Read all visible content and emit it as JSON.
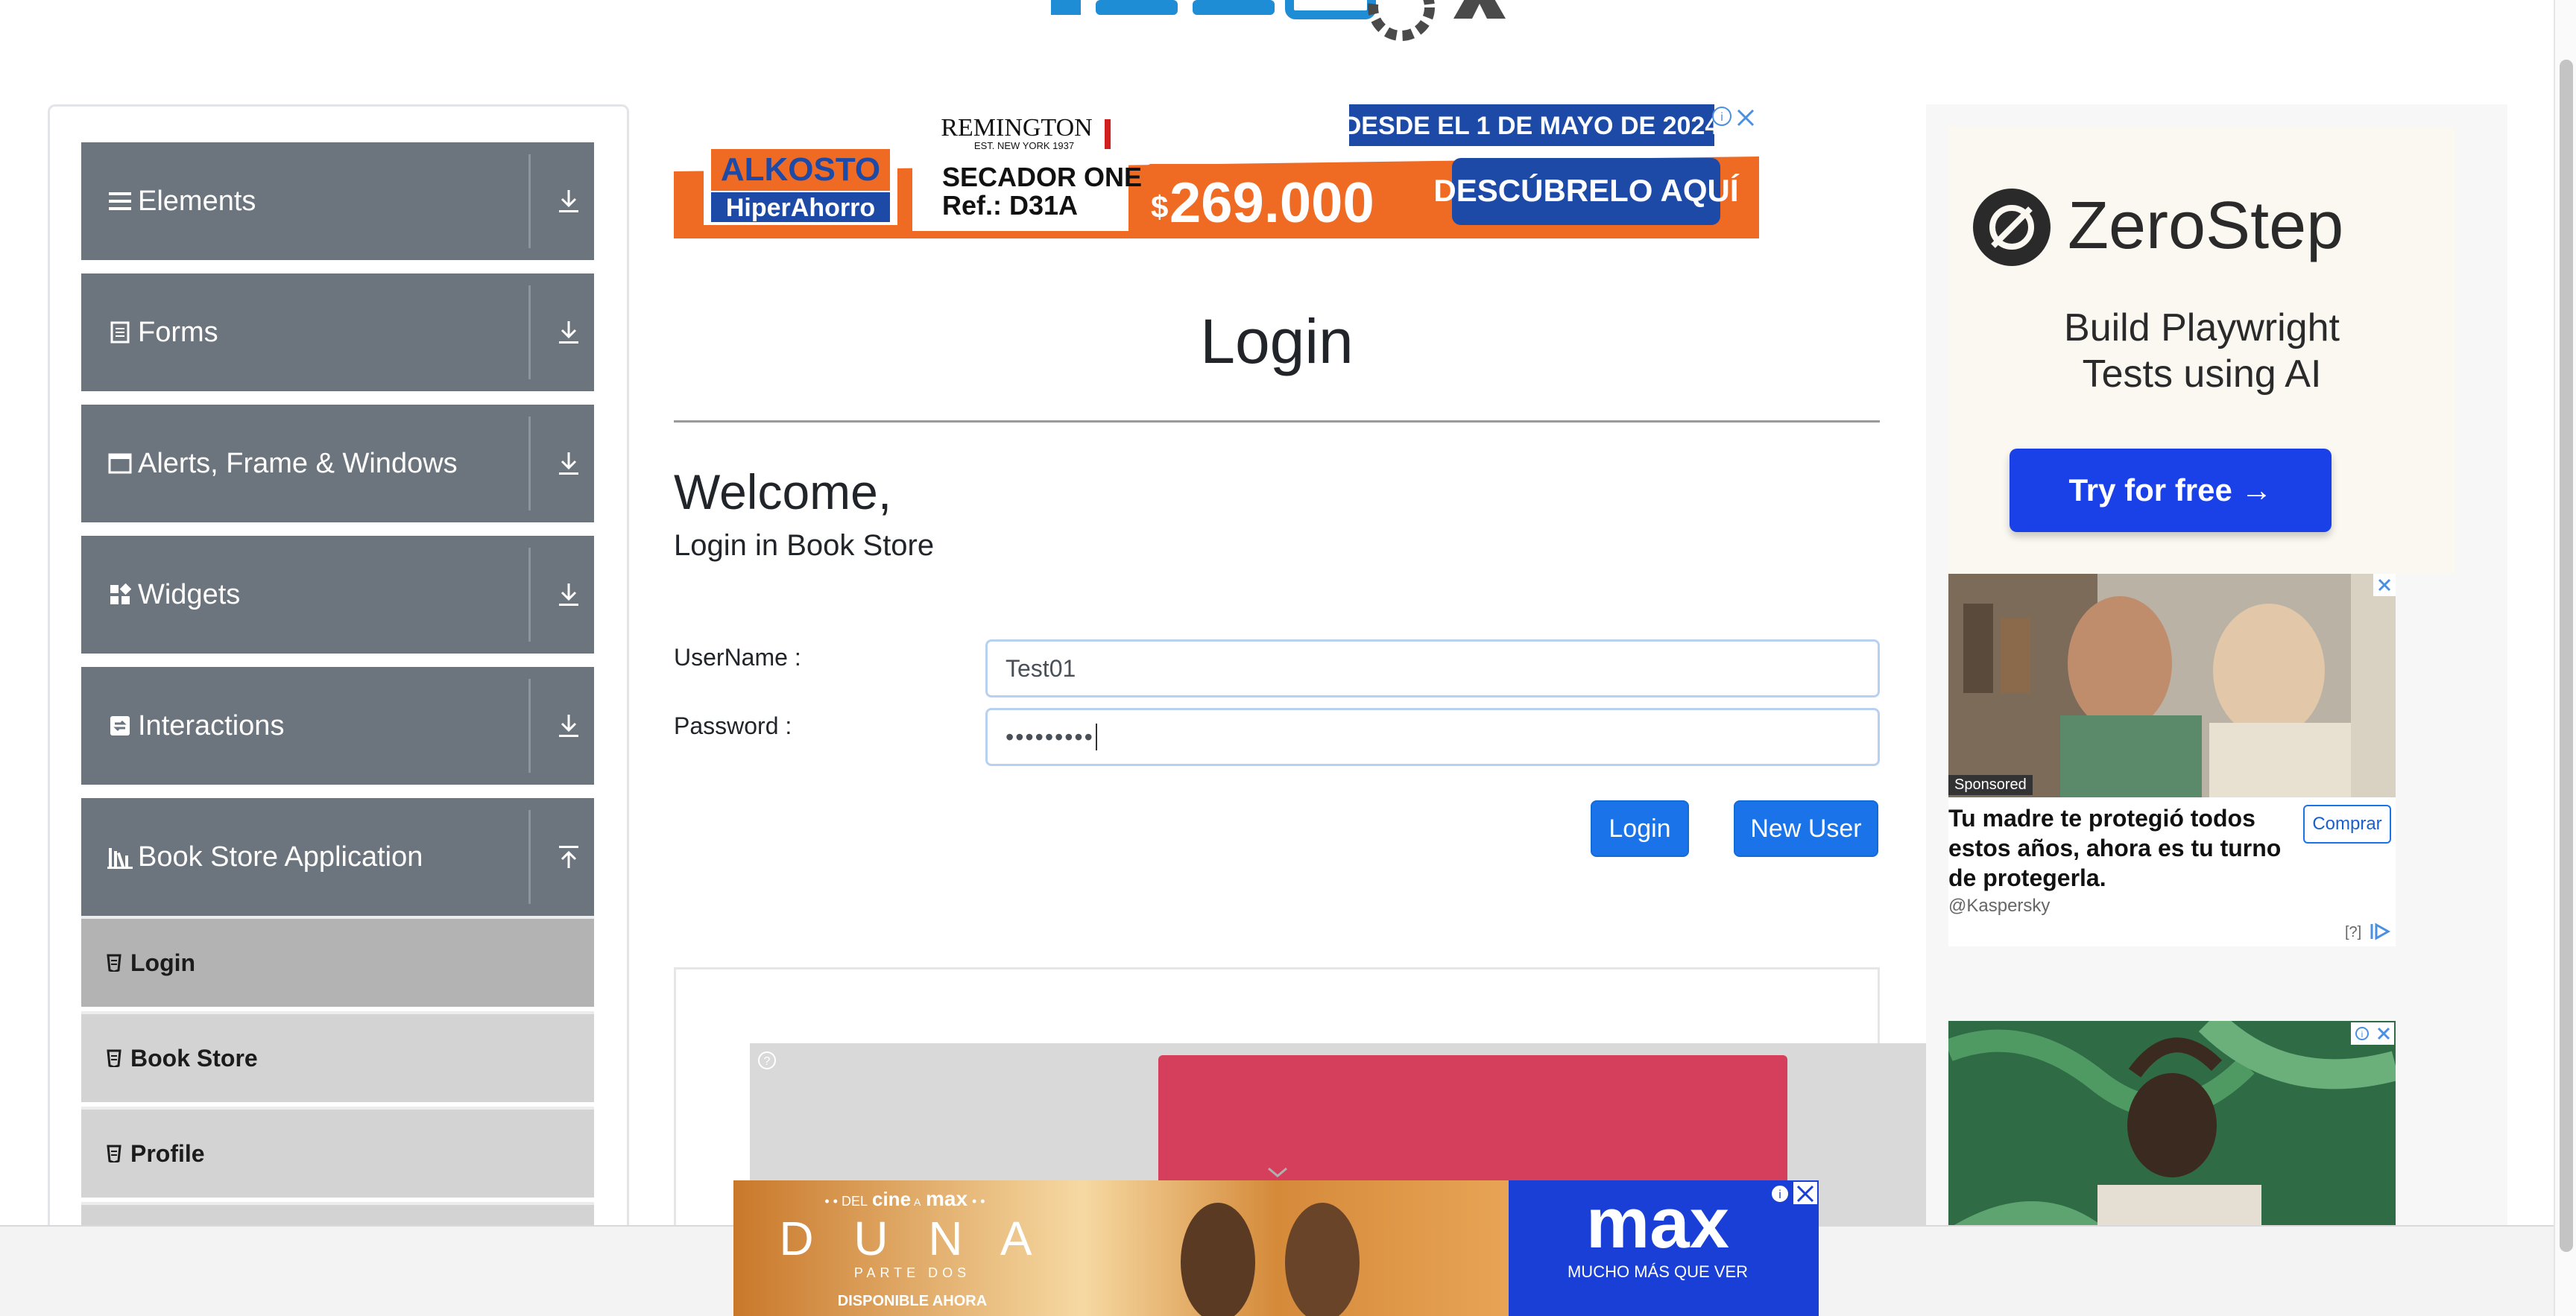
{
  "sidebar": {
    "groups": [
      {
        "title": "Elements",
        "icon": "menu-icon",
        "toggle": "expand-icon"
      },
      {
        "title": "Forms",
        "icon": "document-icon",
        "toggle": "expand-icon"
      },
      {
        "title": "Alerts, Frame & Windows",
        "icon": "window-icon",
        "toggle": "expand-icon"
      },
      {
        "title": "Widgets",
        "icon": "widgets-icon",
        "toggle": "expand-icon"
      },
      {
        "title": "Interactions",
        "icon": "interactions-icon",
        "toggle": "expand-icon"
      },
      {
        "title": "Book Store Application",
        "icon": "books-icon",
        "toggle": "collapse-icon"
      }
    ],
    "items": [
      {
        "label": "Login",
        "active": true
      },
      {
        "label": "Book Store",
        "active": false
      },
      {
        "label": "Profile",
        "active": false
      }
    ]
  },
  "top_ad": {
    "brand": "ALKOSTO",
    "brand_sub": "HiperAhorro",
    "product_brand": "REMINGTON",
    "product_brand_sub": "EST. NEW YORK 1937",
    "product_line1": "SECADOR ONE",
    "product_line2": "Ref.: D31A",
    "date_text": "DESDE EL 1 DE MAYO DE 2024",
    "price_currency": "$",
    "price": "269.000",
    "cta": "DESCÚBRELO AQUÍ"
  },
  "main": {
    "title": "Login",
    "welcome": "Welcome,",
    "subtitle": "Login in Book Store",
    "username_label": "UserName :",
    "username_value": "Test01",
    "password_label": "Password :",
    "password_value": "•••••••••",
    "login_button": "Login",
    "new_user_button": "New User"
  },
  "right_ads": {
    "zerostep_brand": "ZeroStep",
    "zerostep_headline_1": "Build Playwright",
    "zerostep_headline_2": "Tests using AI",
    "zerostep_cta": "Try for free →",
    "sponsored": "Sponsored",
    "kasp_text_1": "Tu madre te protegió todos",
    "kasp_text_2": "estos años, ahora es tu turno",
    "kasp_text_3": "de protegerla.",
    "kasp_handle": "@Kaspersky",
    "kasp_cta": "Comprar",
    "ad_info": "[?]"
  },
  "bottom_ad": {
    "tagline_pre": "• • DEL",
    "tagline_cine": "cine",
    "tagline_a": "A",
    "tagline_max": "max",
    "tagline_post": "• •",
    "movie": "D U N A",
    "movie_sub": "PARTE DOS",
    "available": "DISPONIBLE AHORA",
    "brand": "max",
    "brand_tagline": "MUCHO MÁS QUE VER"
  },
  "colors": {
    "sidebar_header": "#6c757d",
    "sidebar_item": "#d3d3d3",
    "sidebar_item_active": "#b3b3b3",
    "primary_button": "#1a73e8",
    "input_border_focus": "#b8d1f3"
  }
}
